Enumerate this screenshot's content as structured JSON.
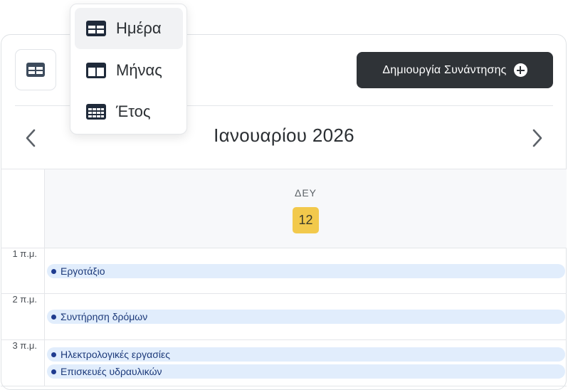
{
  "header": {
    "create_button_label": "Δημιουργία Συνάντησης",
    "month_title": "Ιανουαρίου 2026"
  },
  "view_menu": {
    "items": [
      {
        "label": "Ημέρα",
        "icon": "day-view-icon",
        "active": true
      },
      {
        "label": "Μήνας",
        "icon": "month-view-icon",
        "active": false
      },
      {
        "label": "Έτος",
        "icon": "year-view-icon",
        "active": false
      }
    ]
  },
  "day_column": {
    "weekday": "ΔΕΥ",
    "date": "12"
  },
  "hours": [
    {
      "label": "1 π.μ."
    },
    {
      "label": "2 π.μ."
    },
    {
      "label": "3 π.μ."
    }
  ],
  "events": [
    {
      "title": "Εργοτάξιο"
    },
    {
      "title": "Συντήρηση δρόμων"
    },
    {
      "title": "Ηλεκτρολογικές εργασίες"
    },
    {
      "title": "Επισκευές υδραυλικών"
    }
  ],
  "colors": {
    "accent_dark": "#2f3337",
    "today_badge": "#f2c94c",
    "event_bg": "#e1edfc",
    "event_dot": "#1f3b8f"
  }
}
